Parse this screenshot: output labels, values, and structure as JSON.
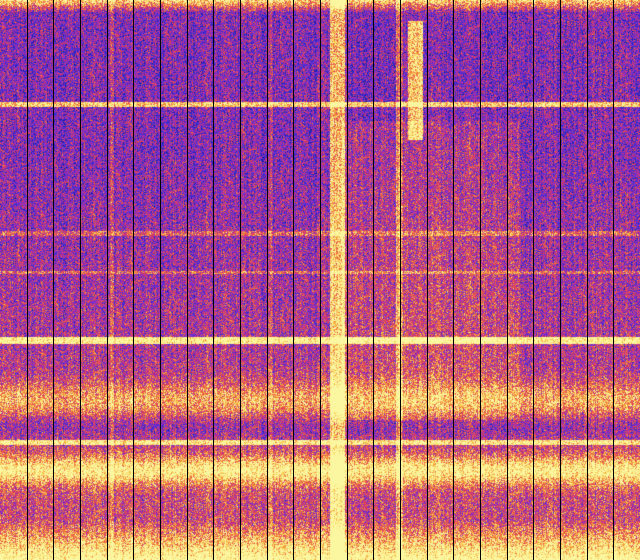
{
  "view": {
    "kind": "spectrogram-waterfall",
    "colormap": [
      "#1a1aa8",
      "#3a2fd0",
      "#7a2fd0",
      "#b0309a",
      "#e0405a",
      "#f07a3a",
      "#f6c64a",
      "#fbf6a0"
    ],
    "background_hot": "#fbf6a0",
    "background_cold": "#1a1aa8",
    "separator_color": "#000000",
    "column_separators_count": 24
  }
}
